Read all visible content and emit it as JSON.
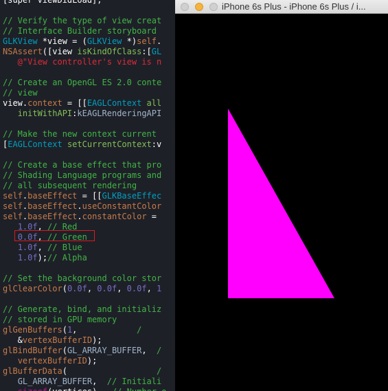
{
  "editor": {
    "lines": [
      {
        "parts": [
          {
            "t": "[super viewDidLoad];",
            "c": "tok-plain"
          }
        ]
      },
      {
        "parts": [
          {
            "t": "",
            "c": "tok-plain"
          }
        ]
      },
      {
        "parts": [
          {
            "t": "// Verify the type of view creat",
            "c": "tok-comment"
          }
        ]
      },
      {
        "parts": [
          {
            "t": "// Interface Builder storyboard",
            "c": "tok-comment"
          }
        ]
      },
      {
        "parts": [
          {
            "t": "GLKView",
            "c": "tok-type"
          },
          {
            "t": " *view = (",
            "c": "tok-plain"
          },
          {
            "t": "GLKView",
            "c": "tok-type"
          },
          {
            "t": " *)",
            "c": "tok-plain"
          },
          {
            "t": "self",
            "c": "tok-self"
          },
          {
            "t": ".",
            "c": "tok-plain"
          }
        ]
      },
      {
        "parts": [
          {
            "t": "NSAssert",
            "c": "tok-macro"
          },
          {
            "t": "([view ",
            "c": "tok-plain"
          },
          {
            "t": "isKindOfClass",
            "c": "tok-method"
          },
          {
            "t": ":[",
            "c": "tok-plain"
          },
          {
            "t": "GL",
            "c": "tok-type"
          }
        ]
      },
      {
        "parts": [
          {
            "t": "   @\"View controller's view is n",
            "c": "tok-string"
          }
        ]
      },
      {
        "parts": [
          {
            "t": "",
            "c": "tok-plain"
          }
        ]
      },
      {
        "parts": [
          {
            "t": "// Create an OpenGL ES 2.0 conte",
            "c": "tok-comment"
          }
        ]
      },
      {
        "parts": [
          {
            "t": "// view",
            "c": "tok-comment"
          }
        ]
      },
      {
        "parts": [
          {
            "t": "view.",
            "c": "tok-plain"
          },
          {
            "t": "context",
            "c": "tok-prop"
          },
          {
            "t": " = [[",
            "c": "tok-plain"
          },
          {
            "t": "EAGLContext",
            "c": "tok-type"
          },
          {
            "t": " all",
            "c": "tok-method"
          }
        ]
      },
      {
        "parts": [
          {
            "t": "   ",
            "c": "tok-plain"
          },
          {
            "t": "initWithAPI",
            "c": "tok-method"
          },
          {
            "t": ":",
            "c": "tok-plain"
          },
          {
            "t": "kEAGLRenderingAPI",
            "c": "tok-const"
          }
        ]
      },
      {
        "parts": [
          {
            "t": "",
            "c": "tok-plain"
          }
        ]
      },
      {
        "parts": [
          {
            "t": "// Make the new context current",
            "c": "tok-comment"
          }
        ]
      },
      {
        "parts": [
          {
            "t": "[",
            "c": "tok-plain"
          },
          {
            "t": "EAGLContext",
            "c": "tok-type"
          },
          {
            "t": " ",
            "c": "tok-plain"
          },
          {
            "t": "setCurrentContext",
            "c": "tok-method"
          },
          {
            "t": ":v",
            "c": "tok-plain"
          }
        ]
      },
      {
        "parts": [
          {
            "t": "",
            "c": "tok-plain"
          }
        ]
      },
      {
        "parts": [
          {
            "t": "// Create a base effect that pro",
            "c": "tok-comment"
          }
        ]
      },
      {
        "parts": [
          {
            "t": "// Shading Language programs and",
            "c": "tok-comment"
          }
        ]
      },
      {
        "parts": [
          {
            "t": "// all subsequent rendering",
            "c": "tok-comment"
          }
        ]
      },
      {
        "parts": [
          {
            "t": "self",
            "c": "tok-self"
          },
          {
            "t": ".",
            "c": "tok-plain"
          },
          {
            "t": "baseEffect",
            "c": "tok-prop"
          },
          {
            "t": " = [[",
            "c": "tok-plain"
          },
          {
            "t": "GLKBaseEffec",
            "c": "tok-type"
          }
        ]
      },
      {
        "parts": [
          {
            "t": "self",
            "c": "tok-self"
          },
          {
            "t": ".",
            "c": "tok-plain"
          },
          {
            "t": "baseEffect",
            "c": "tok-prop"
          },
          {
            "t": ".",
            "c": "tok-plain"
          },
          {
            "t": "useConstantColor",
            "c": "tok-prop"
          }
        ]
      },
      {
        "parts": [
          {
            "t": "self",
            "c": "tok-self"
          },
          {
            "t": ".",
            "c": "tok-plain"
          },
          {
            "t": "baseEffect",
            "c": "tok-prop"
          },
          {
            "t": ".",
            "c": "tok-plain"
          },
          {
            "t": "constantColor",
            "c": "tok-prop"
          },
          {
            "t": " =",
            "c": "tok-plain"
          }
        ]
      },
      {
        "parts": [
          {
            "t": "   ",
            "c": "tok-plain"
          },
          {
            "t": "1.0f",
            "c": "tok-number"
          },
          {
            "t": ", ",
            "c": "tok-plain"
          },
          {
            "t": "// Red",
            "c": "tok-comment"
          }
        ]
      },
      {
        "parts": [
          {
            "t": "   ",
            "c": "tok-plain"
          },
          {
            "t": "0.0f",
            "c": "tok-number"
          },
          {
            "t": ", ",
            "c": "tok-plain"
          },
          {
            "t": "// Green",
            "c": "tok-comment"
          }
        ]
      },
      {
        "parts": [
          {
            "t": "   ",
            "c": "tok-plain"
          },
          {
            "t": "1.0f",
            "c": "tok-number"
          },
          {
            "t": ", ",
            "c": "tok-plain"
          },
          {
            "t": "// Blue",
            "c": "tok-comment"
          }
        ]
      },
      {
        "parts": [
          {
            "t": "   ",
            "c": "tok-plain"
          },
          {
            "t": "1.0f",
            "c": "tok-number"
          },
          {
            "t": ");",
            "c": "tok-plain"
          },
          {
            "t": "// Alpha",
            "c": "tok-comment"
          }
        ]
      },
      {
        "parts": [
          {
            "t": "",
            "c": "tok-plain"
          }
        ]
      },
      {
        "parts": [
          {
            "t": "// Set the background color stor",
            "c": "tok-comment"
          }
        ]
      },
      {
        "parts": [
          {
            "t": "glClearColor",
            "c": "tok-macro"
          },
          {
            "t": "(",
            "c": "tok-plain"
          },
          {
            "t": "0.0f",
            "c": "tok-number"
          },
          {
            "t": ", ",
            "c": "tok-plain"
          },
          {
            "t": "0.0f",
            "c": "tok-number"
          },
          {
            "t": ", ",
            "c": "tok-plain"
          },
          {
            "t": "0.0f",
            "c": "tok-number"
          },
          {
            "t": ", ",
            "c": "tok-plain"
          },
          {
            "t": "1",
            "c": "tok-number"
          }
        ]
      },
      {
        "parts": [
          {
            "t": "",
            "c": "tok-plain"
          }
        ]
      },
      {
        "parts": [
          {
            "t": "// Generate, bind, and initializ",
            "c": "tok-comment"
          }
        ]
      },
      {
        "parts": [
          {
            "t": "// stored in GPU memory",
            "c": "tok-comment"
          }
        ]
      },
      {
        "parts": [
          {
            "t": "glGenBuffers",
            "c": "tok-macro"
          },
          {
            "t": "(",
            "c": "tok-plain"
          },
          {
            "t": "1",
            "c": "tok-number"
          },
          {
            "t": ",            ",
            "c": "tok-plain"
          },
          {
            "t": "/",
            "c": "tok-comment"
          }
        ]
      },
      {
        "parts": [
          {
            "t": "   &",
            "c": "tok-plain"
          },
          {
            "t": "vertexBufferID",
            "c": "tok-prop"
          },
          {
            "t": ");",
            "c": "tok-plain"
          }
        ]
      },
      {
        "parts": [
          {
            "t": "glBindBuffer",
            "c": "tok-macro"
          },
          {
            "t": "(",
            "c": "tok-plain"
          },
          {
            "t": "GL_ARRAY_BUFFER",
            "c": "tok-const"
          },
          {
            "t": ",  ",
            "c": "tok-plain"
          },
          {
            "t": "/",
            "c": "tok-comment"
          }
        ]
      },
      {
        "parts": [
          {
            "t": "   ",
            "c": "tok-plain"
          },
          {
            "t": "vertexBufferID",
            "c": "tok-prop"
          },
          {
            "t": ");",
            "c": "tok-plain"
          }
        ]
      },
      {
        "parts": [
          {
            "t": "glBufferData",
            "c": "tok-macro"
          },
          {
            "t": "(                  ",
            "c": "tok-plain"
          },
          {
            "t": "/",
            "c": "tok-comment"
          }
        ]
      },
      {
        "parts": [
          {
            "t": "   ",
            "c": "tok-plain"
          },
          {
            "t": "GL_ARRAY_BUFFER",
            "c": "tok-const"
          },
          {
            "t": ",  ",
            "c": "tok-plain"
          },
          {
            "t": "// Initiali",
            "c": "tok-comment"
          }
        ]
      },
      {
        "parts": [
          {
            "t": "   ",
            "c": "tok-plain"
          },
          {
            "t": "sizeof",
            "c": "tok-keyword"
          },
          {
            "t": "(vertices),  ",
            "c": "tok-plain"
          },
          {
            "t": "// Number o",
            "c": "tok-comment"
          }
        ]
      }
    ]
  },
  "simulator": {
    "title": "iPhone 6s Plus - iPhone 6s Plus / i...",
    "background": "#000000",
    "triangle_color": "#ff00ff"
  }
}
